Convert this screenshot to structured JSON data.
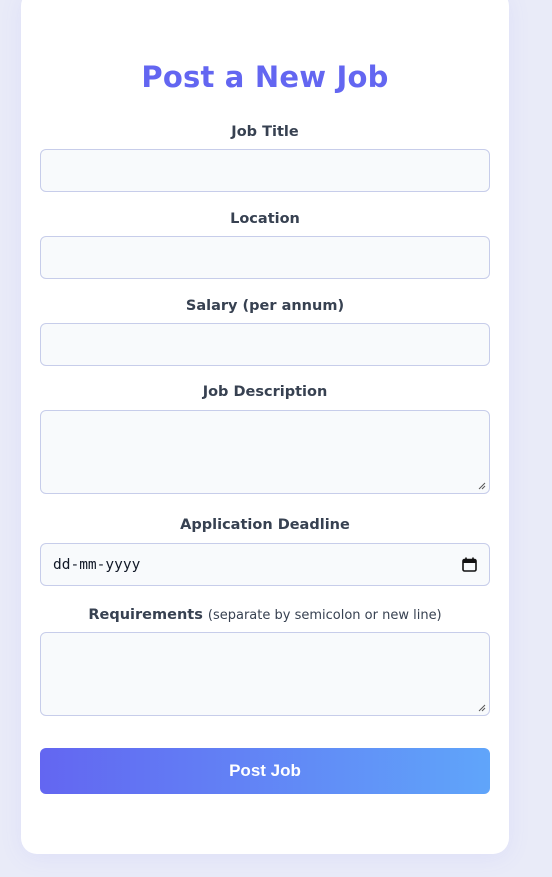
{
  "form": {
    "title": "Post a New Job",
    "fields": {
      "job_title": {
        "label": "Job Title",
        "value": "",
        "placeholder": ""
      },
      "location": {
        "label": "Location",
        "value": "",
        "placeholder": ""
      },
      "salary": {
        "label": "Salary (per annum)",
        "value": "",
        "placeholder": ""
      },
      "description": {
        "label": "Job Description",
        "value": "",
        "placeholder": ""
      },
      "deadline": {
        "label": "Application Deadline",
        "display": "dd-mm-yyyy"
      },
      "requirements": {
        "label": "Requirements",
        "hint": "(separate by semicolon or new line)",
        "value": "",
        "placeholder": ""
      }
    },
    "submit_label": "Post Job"
  },
  "colors": {
    "accent": "#6366f1",
    "gradient_end": "#60a5fa",
    "input_bg": "#f8fafc",
    "input_border": "#c7cdea",
    "page_bg": "#e9ebf8"
  }
}
